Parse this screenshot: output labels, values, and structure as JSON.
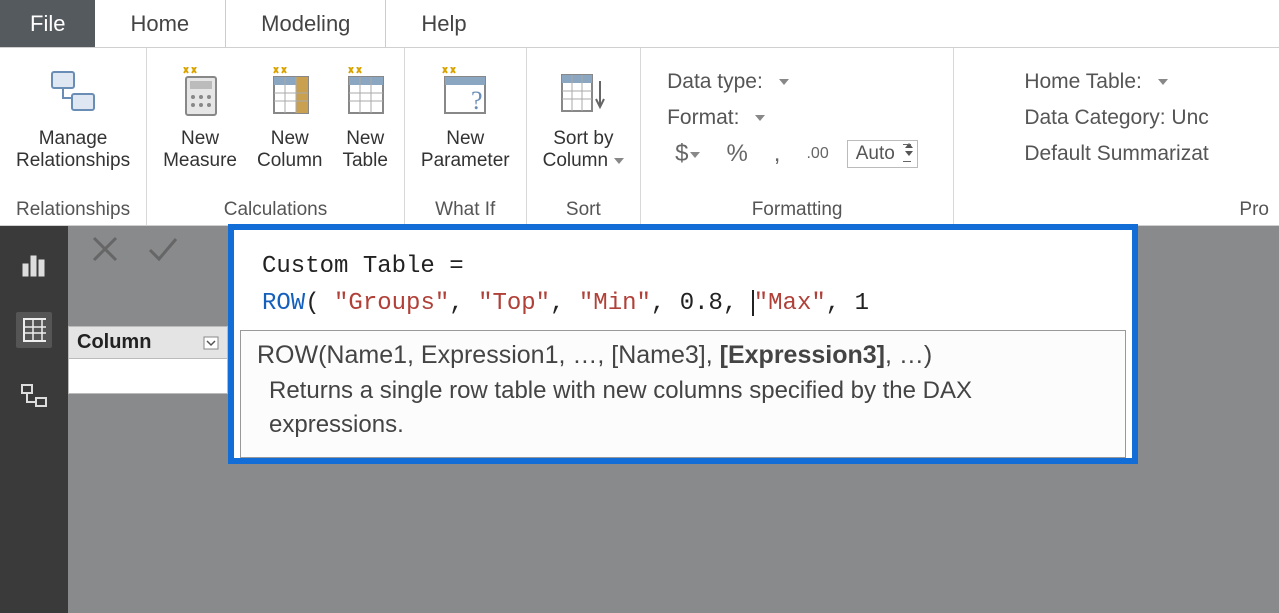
{
  "tabs": {
    "file": "File",
    "home": "Home",
    "modeling": "Modeling",
    "help": "Help"
  },
  "ribbon": {
    "relationships": {
      "btn": "Manage\nRelationships",
      "group": "Relationships"
    },
    "calculations": {
      "measure": "New\nMeasure",
      "column": "New\nColumn",
      "table": "New\nTable",
      "group": "Calculations"
    },
    "whatif": {
      "btn": "New\nParameter",
      "group": "What If"
    },
    "sort": {
      "btn": "Sort by\nColumn",
      "group": "Sort"
    },
    "formatting": {
      "data_type": "Data type:",
      "format": "Format:",
      "currency": "$",
      "percent": "%",
      "thousands": ",",
      "decimals": ".00",
      "decimals_value": "Auto",
      "group": "Formatting"
    },
    "properties": {
      "home_table": "Home Table:",
      "category": "Data Category: Unc",
      "summarize": "Default Summarizat",
      "group": "Pro"
    }
  },
  "fields": {
    "header": "Column"
  },
  "formula": {
    "line1_lhs": "Custom Table =",
    "fn": "ROW",
    "args_prefix": "( ",
    "s1": "\"Groups\"",
    "s2": "\"Top\"",
    "s3": "\"Min\"",
    "n1": "0.8",
    "s4": "\"Max\"",
    "n2": "1"
  },
  "tooltip": {
    "sig_plain1": "ROW(Name1, Expression1, …, [Name3], ",
    "sig_bold": "[Expression3]",
    "sig_plain2": ", …)",
    "desc": "Returns a single row table with new columns specified by the DAX expressions."
  }
}
